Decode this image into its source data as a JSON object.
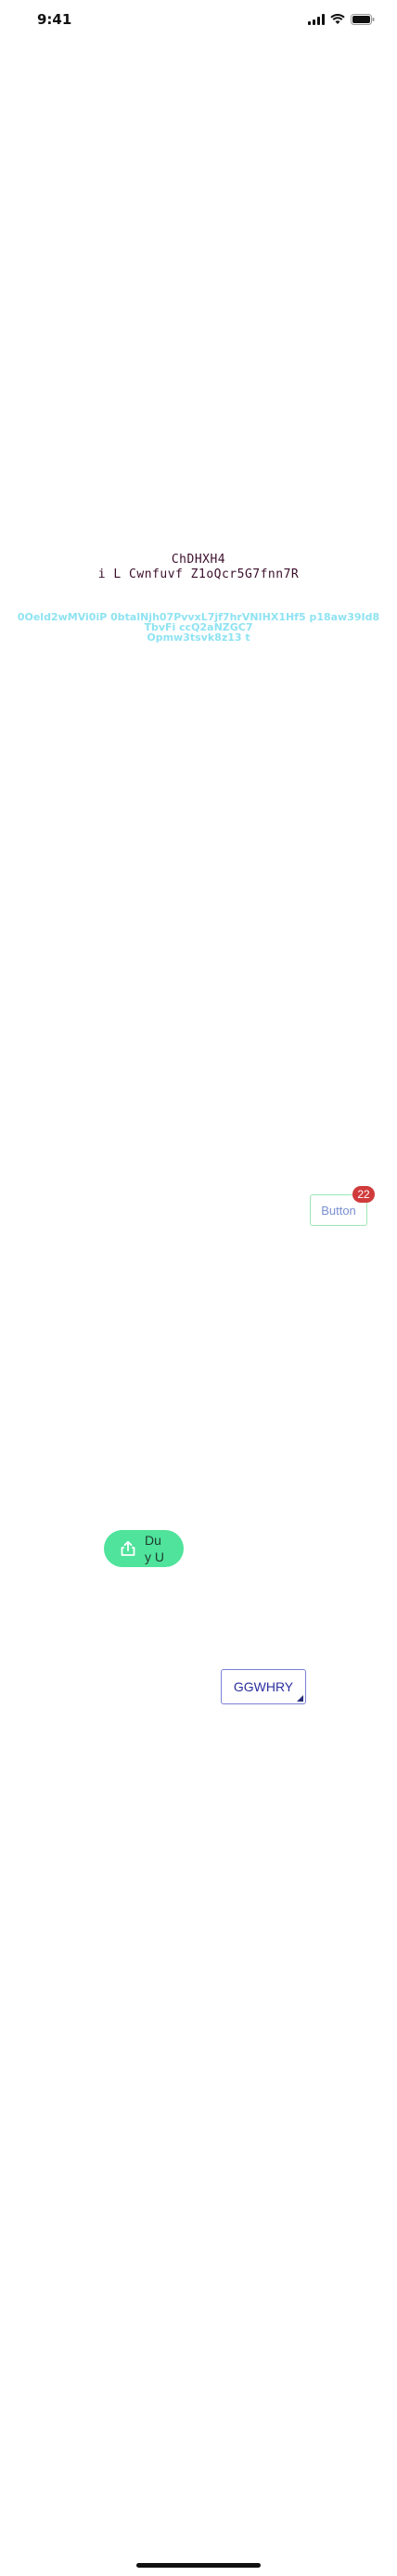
{
  "status_bar": {
    "time": "9:41",
    "icons": [
      "cellular-signal-icon",
      "wifi-icon",
      "battery-icon"
    ]
  },
  "title": {
    "line1": "ChDHXH4",
    "line2": "i L Cwnfuvf Z1oQcr5G7fnn7R"
  },
  "subtitle": {
    "line1": "0Oeld2wMVi0iP 0btalNjh07PvvxL7jf7hrVNIHX1Hf5 p18aw39Id8",
    "line2": "TbvFi ccQ2aNZGC7",
    "line3": "Opmw3tsvk8z13 t",
    "color": "#8fe3f2"
  },
  "badge_button": {
    "label": "Button",
    "badge_count": "22",
    "badge_color": "#d03b3b",
    "border_color": "#9de6b4"
  },
  "pill_button": {
    "icon": "share-icon",
    "label_line1": "Du",
    "label_line2": "y U",
    "color": "#4fe39b"
  },
  "select": {
    "value": "GGWHRY",
    "border_color": "#7b7fd8"
  }
}
